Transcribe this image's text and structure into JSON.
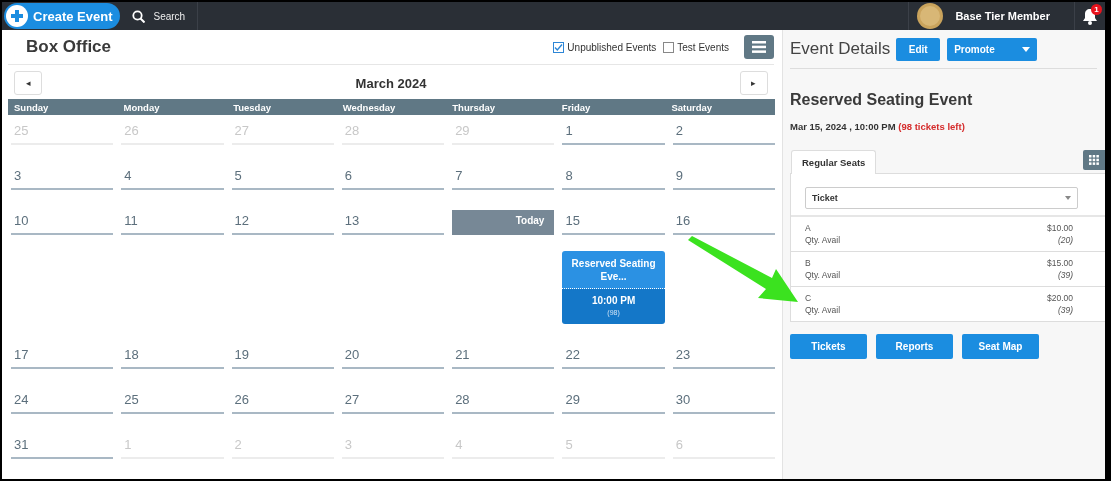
{
  "topbar": {
    "create_button": "Create Event",
    "search": "Search",
    "member": "Base Tier Member",
    "notifications": "1"
  },
  "calendar": {
    "title": "Box Office",
    "filters": [
      {
        "label": "Unpublished Events",
        "checked": true
      },
      {
        "label": "Test Events",
        "checked": false
      }
    ],
    "prev": "◂",
    "next": "▸",
    "month": "March 2024",
    "weekdays": [
      "Sunday",
      "Monday",
      "Tuesday",
      "Wednesday",
      "Thursday",
      "Friday",
      "Saturday"
    ],
    "weeks": [
      {
        "days": [
          {
            "label": "25",
            "outside_month": true,
            "today": false
          },
          {
            "label": "26",
            "outside_month": true,
            "today": false
          },
          {
            "label": "27",
            "outside_month": true,
            "today": false
          },
          {
            "label": "28",
            "outside_month": true,
            "today": false
          },
          {
            "label": "29",
            "outside_month": true,
            "today": false
          },
          {
            "label": "1",
            "outside_month": false,
            "today": false
          },
          {
            "label": "2",
            "outside_month": false,
            "today": false
          }
        ]
      },
      {
        "days": [
          {
            "label": "3",
            "outside_month": false,
            "today": false
          },
          {
            "label": "4",
            "outside_month": false,
            "today": false
          },
          {
            "label": "5",
            "outside_month": false,
            "today": false
          },
          {
            "label": "6",
            "outside_month": false,
            "today": false
          },
          {
            "label": "7",
            "outside_month": false,
            "today": false
          },
          {
            "label": "8",
            "outside_month": false,
            "today": false
          },
          {
            "label": "9",
            "outside_month": false,
            "today": false
          }
        ]
      },
      {
        "days": [
          {
            "label": "10",
            "outside_month": false,
            "today": false
          },
          {
            "label": "11",
            "outside_month": false,
            "today": false
          },
          {
            "label": "12",
            "outside_month": false,
            "today": false
          },
          {
            "label": "13",
            "outside_month": false,
            "today": false
          },
          {
            "label": "Today",
            "outside_month": false,
            "today": true
          },
          {
            "label": "15",
            "outside_month": false,
            "today": false,
            "events": [
              {
                "title": "Reserved Seating Eve...",
                "time": "10:00 PM",
                "count": "(98)"
              }
            ]
          },
          {
            "label": "16",
            "outside_month": false,
            "today": false
          }
        ]
      },
      {
        "days": [
          {
            "label": "17",
            "outside_month": false,
            "today": false
          },
          {
            "label": "18",
            "outside_month": false,
            "today": false
          },
          {
            "label": "19",
            "outside_month": false,
            "today": false
          },
          {
            "label": "20",
            "outside_month": false,
            "today": false
          },
          {
            "label": "21",
            "outside_month": false,
            "today": false
          },
          {
            "label": "22",
            "outside_month": false,
            "today": false
          },
          {
            "label": "23",
            "outside_month": false,
            "today": false
          }
        ]
      },
      {
        "days": [
          {
            "label": "24",
            "outside_month": false,
            "today": false
          },
          {
            "label": "25",
            "outside_month": false,
            "today": false
          },
          {
            "label": "26",
            "outside_month": false,
            "today": false
          },
          {
            "label": "27",
            "outside_month": false,
            "today": false
          },
          {
            "label": "28",
            "outside_month": false,
            "today": false
          },
          {
            "label": "29",
            "outside_month": false,
            "today": false
          },
          {
            "label": "30",
            "outside_month": false,
            "today": false
          }
        ]
      },
      {
        "days": [
          {
            "label": "31",
            "outside_month": false,
            "today": false
          },
          {
            "label": "1",
            "outside_month": true,
            "today": false
          },
          {
            "label": "2",
            "outside_month": true,
            "today": false
          },
          {
            "label": "3",
            "outside_month": true,
            "today": false
          },
          {
            "label": "4",
            "outside_month": true,
            "today": false
          },
          {
            "label": "5",
            "outside_month": true,
            "today": false
          },
          {
            "label": "6",
            "outside_month": true,
            "today": false
          }
        ]
      }
    ]
  },
  "event_details": {
    "heading": "Event Details",
    "edit_button": "Edit",
    "promote_button": "Promote",
    "event_title": "Reserved Seating Event",
    "date": "Mar 15, 2024 , 10:00 PM",
    "tickets_left": "(98 tickets left)",
    "tabs": [
      {
        "label": "Regular Seats",
        "selected": true
      }
    ],
    "ticket_select": "Ticket",
    "tickets": [
      {
        "name": "A",
        "qty_label": "Qty. Avail",
        "price": "$10.00",
        "qty": "(20)"
      },
      {
        "name": "B",
        "qty_label": "Qty. Avail",
        "price": "$15.00",
        "qty": "(39)"
      },
      {
        "name": "C",
        "qty_label": "Qty. Avail",
        "price": "$20.00",
        "qty": "(39)"
      }
    ],
    "buttons": [
      "Tickets",
      "Reports",
      "Seat Map"
    ]
  }
}
